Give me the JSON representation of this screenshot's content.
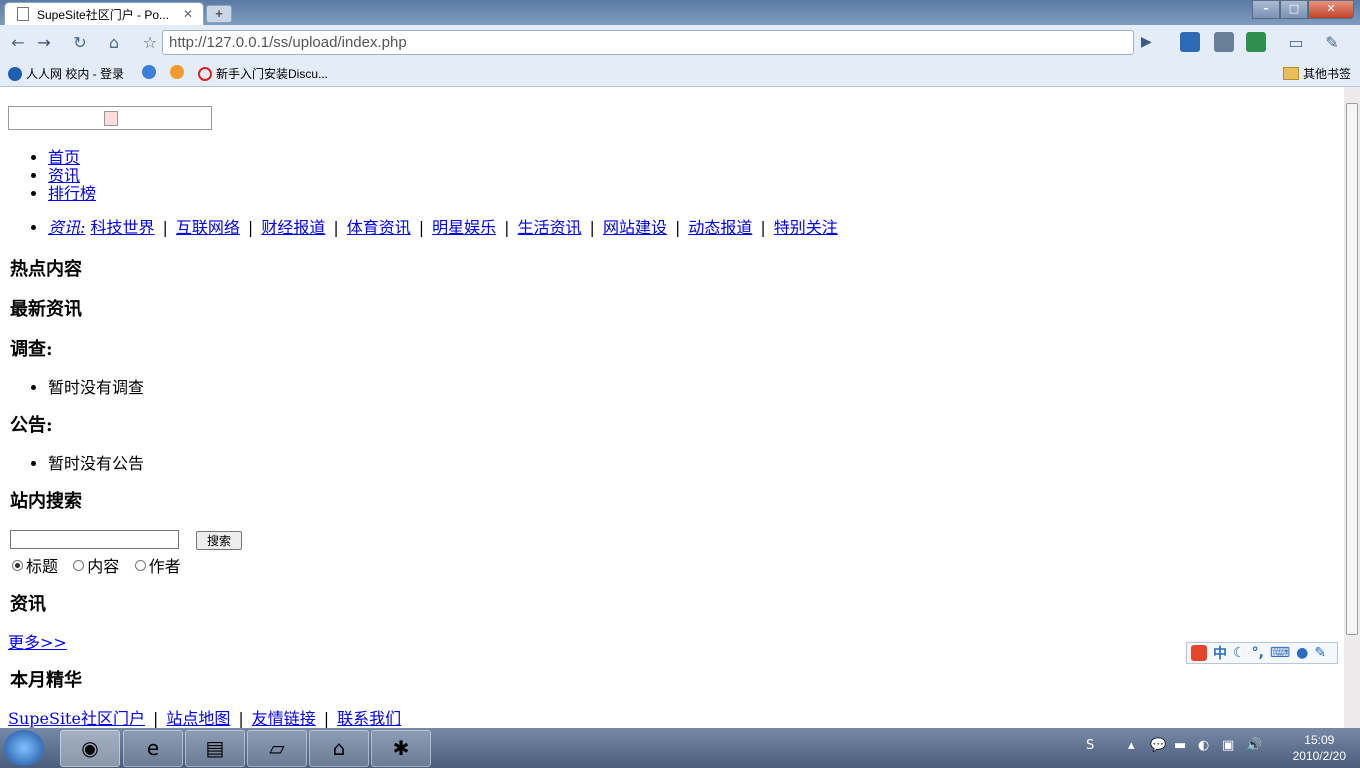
{
  "browser": {
    "tab_title": "SupeSite社区门户 - Po...",
    "url": "http://127.0.0.1/ss/upload/index.php",
    "bookmarks": [
      "人人网 校内 - 登录",
      "新手入门安装Discu..."
    ],
    "other_bookmarks": "其他书签"
  },
  "page": {
    "nav": [
      "首页",
      "资讯",
      "排行榜"
    ],
    "sub_prefix": "资讯:",
    "sub_items": [
      "科技世界",
      "互联网络",
      "财经报道",
      "体育资讯",
      "明星娱乐",
      "生活资讯",
      "网站建设",
      "动态报道",
      "特别关注"
    ],
    "sub_sep": "|",
    "hot": "热点内容",
    "latest": "最新资讯",
    "survey_title": "调查:",
    "survey_empty": "暂时没有调查",
    "notice_title": "公告:",
    "notice_empty": "暂时没有公告",
    "search_title": "站内搜索",
    "search_button": "搜索",
    "search_options": [
      "标题",
      "内容",
      "作者"
    ],
    "news_title": "资讯",
    "more": "更多>>",
    "month_title": "本月精华",
    "footer": [
      "SupeSite社区门户",
      "站点地图",
      "友情链接",
      "联系我们"
    ]
  },
  "ime": {
    "mode": "中"
  },
  "taskbar": {
    "time": "15:09",
    "date": "2010/2/20"
  }
}
